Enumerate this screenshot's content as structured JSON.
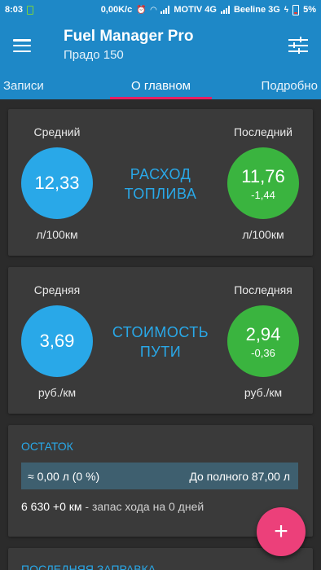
{
  "status": {
    "time": "8:03",
    "speed": "0,00K/c",
    "carrier1": "MOTIV 4G",
    "carrier2": "Beeline 3G",
    "battery": "5%"
  },
  "appbar": {
    "title": "Fuel Manager Pro",
    "subtitle": "Прадо 150"
  },
  "tabs": [
    {
      "label": "Записи"
    },
    {
      "label": "О главном"
    },
    {
      "label": "Подробно"
    }
  ],
  "fuel": {
    "avg_label": "Средний",
    "last_label": "Последний",
    "avg_value": "12,33",
    "last_value": "11,76",
    "last_delta": "-1,44",
    "title_line1": "РАСХОД",
    "title_line2": "ТОПЛИВА",
    "unit_left": "л/100км",
    "unit_right": "л/100км"
  },
  "cost": {
    "avg_label": "Средняя",
    "last_label": "Последняя",
    "avg_value": "3,69",
    "last_value": "2,94",
    "last_delta": "-0,36",
    "title_line1": "СТОИМОСТЬ",
    "title_line2": "ПУТИ",
    "unit_left": "руб./км",
    "unit_right": "руб./км"
  },
  "remainder": {
    "title": "ОСТАТОК",
    "amount": "≈ 0,00 л (0 %)",
    "to_full": "До полного 87,00 л",
    "odometer": "6 630 +0 км",
    "range": " - запас хода на 0 дней"
  },
  "last_refuel": {
    "title": "ПОСЛЕДНЯЯ ЗАПРАВКА"
  },
  "fab": {
    "label": "+"
  },
  "colors": {
    "primary": "#1e88c7",
    "accent": "#29a8e8",
    "green": "#3ab43f",
    "pink": "#ec407a",
    "card": "#3a3a3a",
    "background": "#2b2b2b"
  }
}
